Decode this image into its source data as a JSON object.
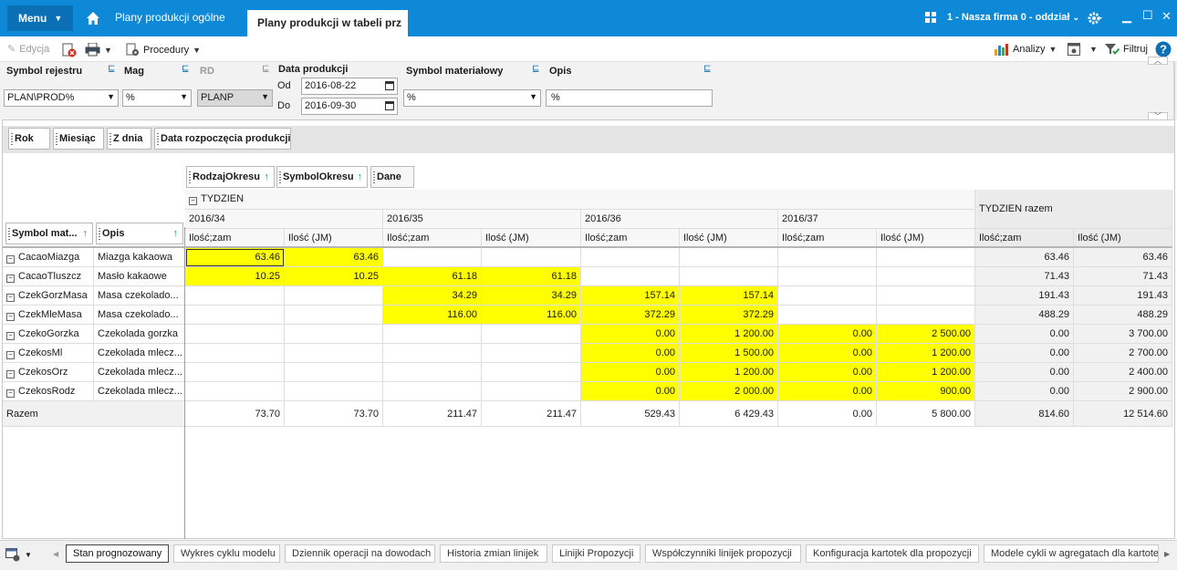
{
  "titlebar": {
    "menu": "Menu",
    "tabs": [
      "Plany produkcji ogólne",
      "Plany produkcji w tabeli prz"
    ],
    "firm": "1 - Nasza firma 0 - oddział",
    "colors": {
      "bar": "#0e89d8",
      "menu": "#0a6fb5"
    }
  },
  "toolbar": {
    "edit": "Edycja",
    "procedures": "Procedury",
    "analytics": "Analizy",
    "filter": "Filtruj"
  },
  "filters": {
    "symbol_rejestru": {
      "label": "Symbol rejestru",
      "value": "PLAN\\PROD%"
    },
    "mag": {
      "label": "Mag",
      "value": "%"
    },
    "rd": {
      "label": "RD",
      "value": "PLANP"
    },
    "data_produkcji": {
      "label": "Data produkcji",
      "from_label": "Od",
      "from": "2016-08-22",
      "to_label": "Do",
      "to": "2016-09-30"
    },
    "symbol_materialowy": {
      "label": "Symbol materiałowy",
      "value": "%"
    },
    "opis": {
      "label": "Opis",
      "value": "%"
    }
  },
  "pivot": {
    "row_area_chips": [
      "Rok",
      "Miesiąc",
      "Z dnia",
      "Data rozpoczęcia produkcji"
    ],
    "column_chips": [
      "RodzajOkresu",
      "SymbolOkresu",
      "Dane"
    ],
    "row_field_chips": [
      "Symbol mat...",
      "Opis"
    ],
    "group": "TYDZIEN",
    "group_total": "TYDZIEN razem",
    "periods": [
      "2016/34",
      "2016/35",
      "2016/36",
      "2016/37"
    ],
    "measures": [
      "Ilość;zam",
      "Ilość (JM)"
    ],
    "rows": [
      {
        "symbol": "CacaoMiazga",
        "opis": "Miazga kakaowa",
        "values": [
          "63.46",
          "63.46",
          "",
          "",
          "",
          "",
          "",
          ""
        ],
        "total": [
          "63.46",
          "63.46"
        ]
      },
      {
        "symbol": "CacaoTluszcz",
        "opis": "Masło kakaowe",
        "values": [
          "10.25",
          "10.25",
          "61.18",
          "61.18",
          "",
          "",
          "",
          ""
        ],
        "total": [
          "71.43",
          "71.43"
        ]
      },
      {
        "symbol": "CzekGorzMasa",
        "opis": "Masa czekolado...",
        "values": [
          "",
          "",
          "34.29",
          "34.29",
          "157.14",
          "157.14",
          "",
          ""
        ],
        "total": [
          "191.43",
          "191.43"
        ]
      },
      {
        "symbol": "CzekMleMasa",
        "opis": "Masa czekolado...",
        "values": [
          "",
          "",
          "116.00",
          "116.00",
          "372.29",
          "372.29",
          "",
          ""
        ],
        "total": [
          "488.29",
          "488.29"
        ]
      },
      {
        "symbol": "CzekoGorzka",
        "opis": "Czekolada gorzka",
        "values": [
          "",
          "",
          "",
          "",
          "0.00",
          "1 200.00",
          "0.00",
          "2 500.00"
        ],
        "total": [
          "0.00",
          "3 700.00"
        ]
      },
      {
        "symbol": "CzekosMl",
        "opis": "Czekolada mlecz...",
        "values": [
          "",
          "",
          "",
          "",
          "0.00",
          "1 500.00",
          "0.00",
          "1 200.00"
        ],
        "total": [
          "0.00",
          "2 700.00"
        ]
      },
      {
        "symbol": "CzekosOrz",
        "opis": "Czekolada mlecz...",
        "values": [
          "",
          "",
          "",
          "",
          "0.00",
          "1 200.00",
          "0.00",
          "1 200.00"
        ],
        "total": [
          "0.00",
          "2 400.00"
        ]
      },
      {
        "symbol": "CzekosRodz",
        "opis": "Czekolada mlecz...",
        "values": [
          "",
          "",
          "",
          "",
          "0.00",
          "2 000.00",
          "0.00",
          "900.00"
        ],
        "total": [
          "0.00",
          "2 900.00"
        ]
      }
    ],
    "grand_label": "Razem",
    "grand_values": [
      "73.70",
      "73.70",
      "211.47",
      "211.47",
      "529.43",
      "6 429.43",
      "0.00",
      "5 800.00"
    ],
    "grand_total": [
      "814.60",
      "12 514.60"
    ],
    "highlight_color": "#ffff00"
  },
  "bottom_tabs": [
    "Stan prognozowany",
    "Wykres cyklu modelu",
    "Dziennik operacji na dowodach",
    "Historia zmian linijek",
    "Linijki Propozycji",
    "Współczynniki linijek propozycji",
    "Konfiguracja kartotek dla propozycji",
    "Modele cykli w agregatach dla kartote"
  ]
}
